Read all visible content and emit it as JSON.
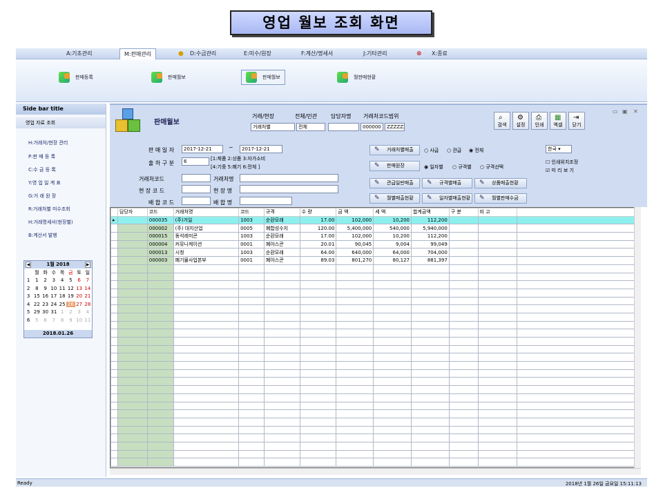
{
  "page_title": "영업 월보 조회 화면",
  "menu": [
    {
      "label": "A:기초관리"
    },
    {
      "label": "M:판매관리"
    },
    {
      "label": "D:수금관리"
    },
    {
      "label": "E:미수/원장"
    },
    {
      "label": "F:계산/명세서"
    },
    {
      "label": "J:기타관리"
    },
    {
      "label": "X:종료"
    }
  ],
  "ribbon": {
    "items": [
      {
        "label": "판매등록"
      },
      {
        "label": "판매월보"
      },
      {
        "label": "판매월보"
      },
      {
        "label": "월판매현황"
      }
    ]
  },
  "sidebar": {
    "title": "Side bar title",
    "section": "영업 자료 조회",
    "items": [
      {
        "label": "H:거래처/현장 관리"
      },
      {
        "label": "P:판 매 등 록"
      },
      {
        "label": "C:수 금 등 록"
      },
      {
        "label": "Y:영 업 일 계 표"
      },
      {
        "label": "G:거 래 원 장"
      },
      {
        "label": "R:거래처별 미수조회"
      },
      {
        "label": "H:거래명세서(현장별)"
      },
      {
        "label": "B:계산서 발행"
      }
    ]
  },
  "calendar": {
    "month": "1월 2018",
    "weekdays": [
      "월",
      "화",
      "수",
      "목",
      "금",
      "토",
      "일"
    ],
    "weeks": [
      [
        "1",
        "2",
        "3",
        "4",
        "5",
        "6",
        "7"
      ],
      [
        "8",
        "9",
        "10",
        "11",
        "12",
        "13",
        "14"
      ],
      [
        "15",
        "16",
        "17",
        "18",
        "19",
        "20",
        "21"
      ],
      [
        "22",
        "23",
        "24",
        "25",
        "26",
        "27",
        "28"
      ],
      [
        "29",
        "30",
        "31",
        "1",
        "2",
        "3",
        "4"
      ],
      [
        "5",
        "6",
        "7",
        "8",
        "9",
        "10",
        "11"
      ]
    ],
    "weeknums": [
      "1",
      "2",
      "3",
      "4",
      "5",
      "6"
    ],
    "today": "2018.01.26"
  },
  "panel": {
    "title": "판매월보",
    "hdr_type": "거래/현장",
    "type_value": "거래처별",
    "hdr_all": "전체/민관",
    "all_value": "전체",
    "hdr_manager": "담당자명",
    "hdr_range": "거래처코드범위",
    "range_from": "000000",
    "range_to": "ZZZZZZ",
    "date_label": "판 매 일 자",
    "date_from": "2017-12-21",
    "date_to": "2017-12-21",
    "tilde": "~",
    "ship_label": "출 하 구 분",
    "ship_value": "6",
    "ship_hint1": "[1:제품 2:상품 3:자가소비",
    "ship_hint2": "[4:기중 5:폐기 6:전체 ]",
    "cust_code": "거래처코드",
    "cust_name": "거래처명",
    "site_code": "현 장 코 드",
    "site_name": "현 장 명",
    "deliv_code": "배 합 코 드",
    "deliv_name": "배 합 명",
    "btn_cust_sales": "거래처별매출",
    "btn_sales_ledger": "판매원장",
    "btn_public_sales": "관급일반매출",
    "btn_spec_sales": "규격별매출",
    "btn_product_sales": "상품매출현황",
    "btn_monthly_sales": "월별매출현황",
    "btn_daily_sales": "일자별매출현황",
    "btn_monthly_collect": "월별판매수금",
    "r1": [
      "사급",
      "관급",
      "전체"
    ],
    "r2": [
      "일자별",
      "규격별",
      "규격선택"
    ],
    "lang": "한국",
    "chk1": "인쇄위치조정",
    "chk2": "미 리 보 기"
  },
  "toolbar": [
    {
      "label": "검색"
    },
    {
      "label": "설정"
    },
    {
      "label": "인쇄"
    },
    {
      "label": "엑셀"
    },
    {
      "label": "닫기"
    }
  ],
  "window_controls": [
    "▭",
    "▣",
    "✕"
  ],
  "grid": {
    "headers": [
      "담당자",
      "코드",
      "거래처명",
      "코드",
      "규격",
      "수 량",
      "금 액",
      "세 액",
      "합계금액",
      "구 분",
      "비 고"
    ],
    "rows": [
      [
        "",
        "000035",
        "(주)거일",
        "1003",
        "순환모래",
        "17.00",
        "102,000",
        "10,200",
        "112,200",
        "",
        ""
      ],
      [
        "",
        "000002",
        "(주) 대지산업",
        "0005",
        "폐합성수지",
        "120.00",
        "5,400,000",
        "540,000",
        "5,940,000",
        "",
        ""
      ],
      [
        "",
        "000015",
        "동석레미콘",
        "1003",
        "순환모래",
        "17.00",
        "102,000",
        "10,200",
        "112,200",
        "",
        ""
      ],
      [
        "",
        "000004",
        "커뮤니케이션",
        "0001",
        "폐아스콘",
        "20.01",
        "90,045",
        "9,004",
        "99,049",
        "",
        ""
      ],
      [
        "",
        "000013",
        "시청",
        "1003",
        "순환모래",
        "64.00",
        "640,000",
        "64,000",
        "704,000",
        "",
        ""
      ],
      [
        "",
        "000003",
        "폐기물사업본부",
        "0001",
        "폐아스콘",
        "89.03",
        "801,270",
        "80,127",
        "881,397",
        "",
        ""
      ]
    ]
  },
  "status": {
    "left": "Ready",
    "right": "2018년 1월 26일 금요일 15:11:13"
  }
}
